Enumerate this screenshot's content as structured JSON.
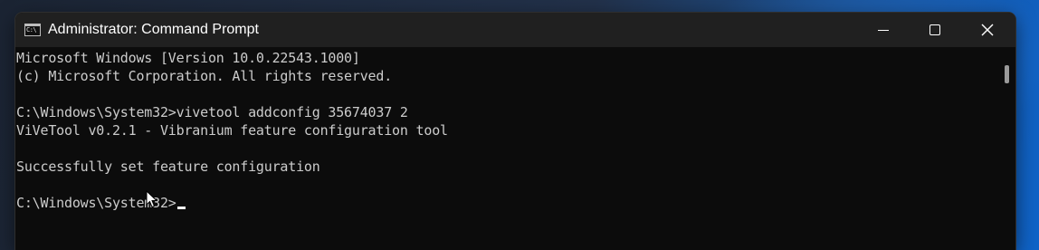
{
  "window": {
    "title": "Administrator: Command Prompt",
    "icon": "cmd-app-icon",
    "icon_text": "C:\\"
  },
  "controls": {
    "minimize_icon": "minimize-icon",
    "maximize_icon": "maximize-icon",
    "close_icon": "close-icon"
  },
  "console": {
    "lines": [
      "Microsoft Windows [Version 10.0.22543.1000]",
      "(c) Microsoft Corporation. All rights reserved.",
      "",
      "C:\\Windows\\System32>vivetool addconfig 35674037 2",
      "ViVeTool v0.2.1 - Vibranium feature configuration tool",
      "",
      "Successfully set feature configuration",
      "",
      "C:\\Windows\\System32>"
    ],
    "text_color": "#cccccc",
    "background_color": "#0c0c0c"
  },
  "colors": {
    "titlebar": "#202020",
    "title_text": "#ffffff"
  }
}
